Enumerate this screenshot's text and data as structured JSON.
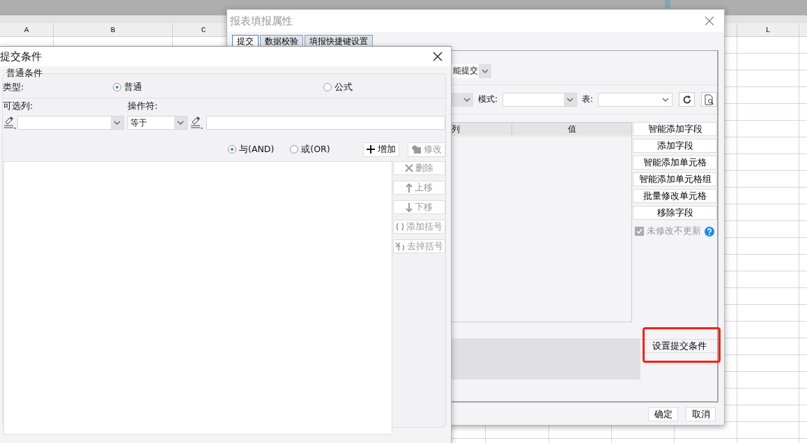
{
  "spreadsheet": {
    "columns": [
      {
        "label": "A"
      },
      {
        "label": "B"
      },
      {
        "label": "C"
      },
      {
        "label": "L"
      }
    ]
  },
  "properties_dialog": {
    "title": "报表填报属性",
    "tabs": [
      {
        "label": "提交",
        "selected": true
      },
      {
        "label": "数据校验",
        "selected": false
      },
      {
        "label": "填报快捷键设置",
        "selected": false
      }
    ],
    "submit_type": {
      "value": "能提交"
    },
    "mode_label": "模式:",
    "table_label": "表:",
    "grid_columns": [
      "列",
      "值"
    ],
    "side_buttons": [
      "智能添加字段",
      "添加字段",
      "智能添加单元格",
      "智能添加单元格组",
      "批量修改单元格",
      "移除字段"
    ],
    "no_update_unmodified": {
      "label": "未修改不更新",
      "checked": true,
      "disabled": true
    },
    "condition_button": "设置提交条件",
    "footer_buttons": [
      "确定",
      "取消"
    ]
  },
  "condition_dialog": {
    "title": "提交条件",
    "group_title": "普通条件",
    "type_label": "类型:",
    "type_options": [
      {
        "label": "普通",
        "selected": true
      },
      {
        "label": "公式",
        "selected": false
      }
    ],
    "column_label": "可选列:",
    "operator_label": "操作符:",
    "operator": {
      "value": "等于"
    },
    "logic_options": [
      {
        "label": "与(AND)",
        "selected": true
      },
      {
        "label": "或(OR)",
        "selected": false
      }
    ],
    "add_button": {
      "label": "增加",
      "disabled": false
    },
    "edit_button": {
      "label": "修改",
      "disabled": true
    },
    "list_buttons": [
      {
        "kind": "delete",
        "label": "删除",
        "disabled": true
      },
      {
        "kind": "up",
        "label": "上移",
        "disabled": true
      },
      {
        "kind": "down",
        "label": "下移",
        "disabled": true
      },
      {
        "kind": "add-paren",
        "label": "添加括号",
        "disabled": true
      },
      {
        "kind": "remove-paren",
        "label": "去掉括号",
        "disabled": true
      }
    ]
  }
}
